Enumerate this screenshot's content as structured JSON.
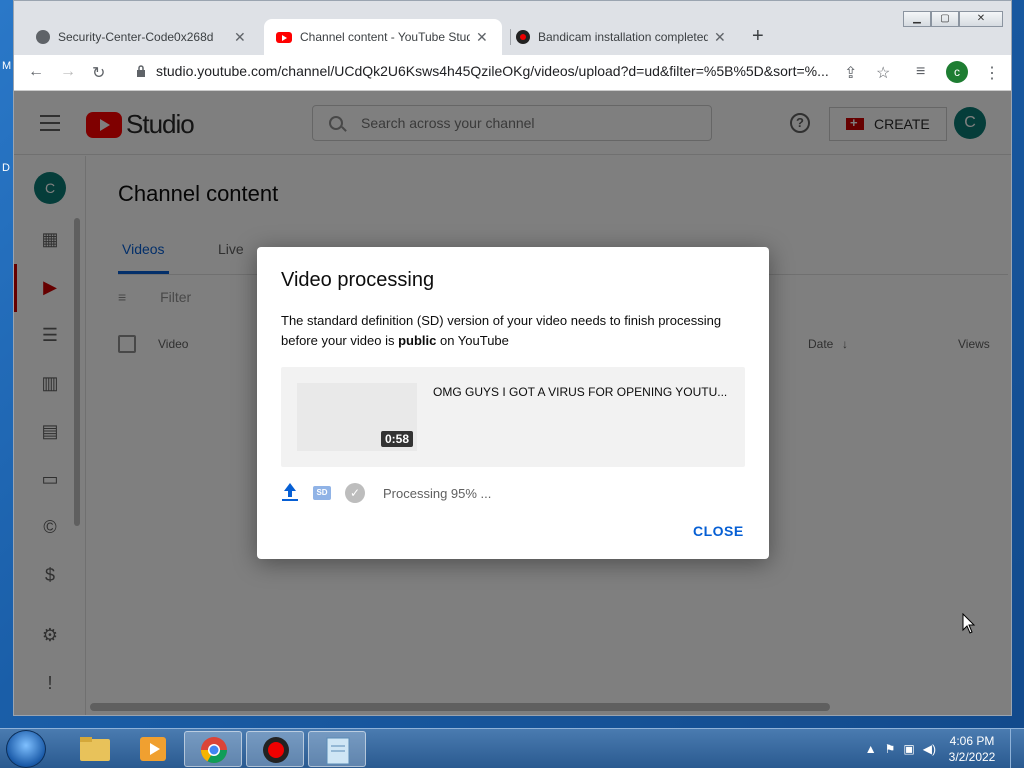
{
  "desktop": {
    "left_letter_1": "M",
    "left_letter_2": "D"
  },
  "browser": {
    "tabs": [
      {
        "title": "Security-Center-Code0x268d",
        "icon": "globe-icon"
      },
      {
        "title": "Channel content - YouTube Studio",
        "icon": "youtube-icon"
      },
      {
        "title": "Bandicam installation completed",
        "icon": "record-icon"
      }
    ],
    "url": "studio.youtube.com/channel/UCdQk2U6Ksws4h45QzileOKg/videos/upload?d=ud&filter=%5B%5D&sort=%...",
    "profile_initial": "c"
  },
  "studio": {
    "logo_text": "Studio",
    "search_placeholder": "Search across your channel",
    "create_label": "CREATE",
    "avatar_initial": "C",
    "page_title": "Channel content",
    "tabs": [
      {
        "label": "Videos"
      },
      {
        "label": "Live"
      }
    ],
    "filter_label": "Filter",
    "columns": {
      "video": "Video",
      "date": "Date",
      "views": "Views"
    }
  },
  "dialog": {
    "title": "Video processing",
    "message_part1": "The standard definition (SD) version of your video needs to finish processing before your video is ",
    "message_bold": "public",
    "message_part2": " on YouTube",
    "video_title": "OMG GUYS I GOT A VIRUS FOR OPENING YOUTU...",
    "duration": "0:58",
    "status_text": "Processing 95% ...",
    "close_label": "CLOSE",
    "processing_percent": 95
  },
  "taskbar": {
    "time": "4:06 PM",
    "date": "3/2/2022"
  },
  "colors": {
    "accent": "#065fd4",
    "brand_red": "#ff0000",
    "avatar_teal": "#0a7b74"
  }
}
